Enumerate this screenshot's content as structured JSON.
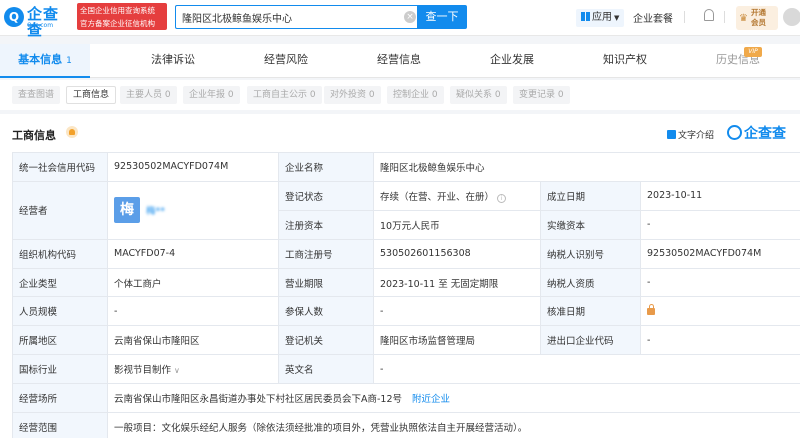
{
  "header": {
    "logo_glyph": "Q",
    "logo_text": "企查查",
    "logo_sub": "Qcc.com",
    "banner_line1": "全国企业信用查询系统",
    "banner_line2": "官方备案企业征信机构",
    "search_value": "隆阳区北极鲸鱼娱乐中心",
    "search_button": "查一下",
    "app_label": "应用",
    "app_menu": "企业套餐",
    "vip_line1": "开通",
    "vip_line2": "会员"
  },
  "tabs": [
    {
      "label": "基本信息",
      "count": "1"
    },
    {
      "label": "法律诉讼"
    },
    {
      "label": "经营风险"
    },
    {
      "label": "经营信息"
    },
    {
      "label": "企业发展"
    },
    {
      "label": "知识产权"
    },
    {
      "label": "历史信息",
      "badge": "VIP"
    }
  ],
  "subtabs": [
    {
      "label": "查查图谱"
    },
    {
      "label": "工商信息"
    },
    {
      "label": "主要人员",
      "count": "0"
    },
    {
      "label": "企业年报",
      "count": "0"
    },
    {
      "label": "工商自主公示",
      "count": "0"
    },
    {
      "label": "对外投资",
      "count": "0"
    },
    {
      "label": "控制企业",
      "count": "0"
    },
    {
      "label": "疑似关系",
      "count": "0"
    },
    {
      "label": "变更记录",
      "count": "0"
    }
  ],
  "card": {
    "title": "工商信息",
    "intro_link": "文字介绍",
    "brand": "企查查"
  },
  "info": {
    "uscc_label": "统一社会信用代码",
    "uscc": "92530502MACYFD074M",
    "name_label": "企业名称",
    "name": "隆阳区北极鲸鱼娱乐中心",
    "operator_label": "经营者",
    "operator_avatar": "梅",
    "operator_name": "梅**",
    "status_label": "登记状态",
    "status": "存续（在营、开业、在册）",
    "established_label": "成立日期",
    "established": "2023-10-11",
    "reg_capital_label": "注册资本",
    "reg_capital": "10万元人民币",
    "paid_capital_label": "实缴资本",
    "paid_capital": "-",
    "org_code_label": "组织机构代码",
    "org_code": "MACYFD07-4",
    "reg_no_label": "工商注册号",
    "reg_no": "530502601156308",
    "taxpayer_id_label": "纳税人识别号",
    "taxpayer_id": "92530502MACYFD074M",
    "type_label": "企业类型",
    "type": "个体工商户",
    "term_label": "营业期限",
    "term": "2023-10-11 至 无固定期限",
    "taxpayer_qual_label": "纳税人资质",
    "taxpayer_qual": "-",
    "staff_label": "人员规模",
    "staff": "-",
    "insured_label": "参保人数",
    "insured": "-",
    "approved_label": "核准日期",
    "region_label": "所属地区",
    "region": "云南省保山市隆阳区",
    "authority_label": "登记机关",
    "authority": "隆阳区市场监督管理局",
    "ie_code_label": "进出口企业代码",
    "ie_code": "-",
    "industry_label": "国标行业",
    "industry": "影视节目制作",
    "english_label": "英文名",
    "english": "-",
    "address_label": "经营场所",
    "address": "云南省保山市隆阳区永昌街道办事处下村社区居民委员会下A商-12号",
    "address_link": "附近企业",
    "scope_label": "经营范围",
    "scope": "一般项目：文化娱乐经纪人服务（除依法须经批准的项目外，凭营业执照依法自主开展经营活动）。"
  }
}
